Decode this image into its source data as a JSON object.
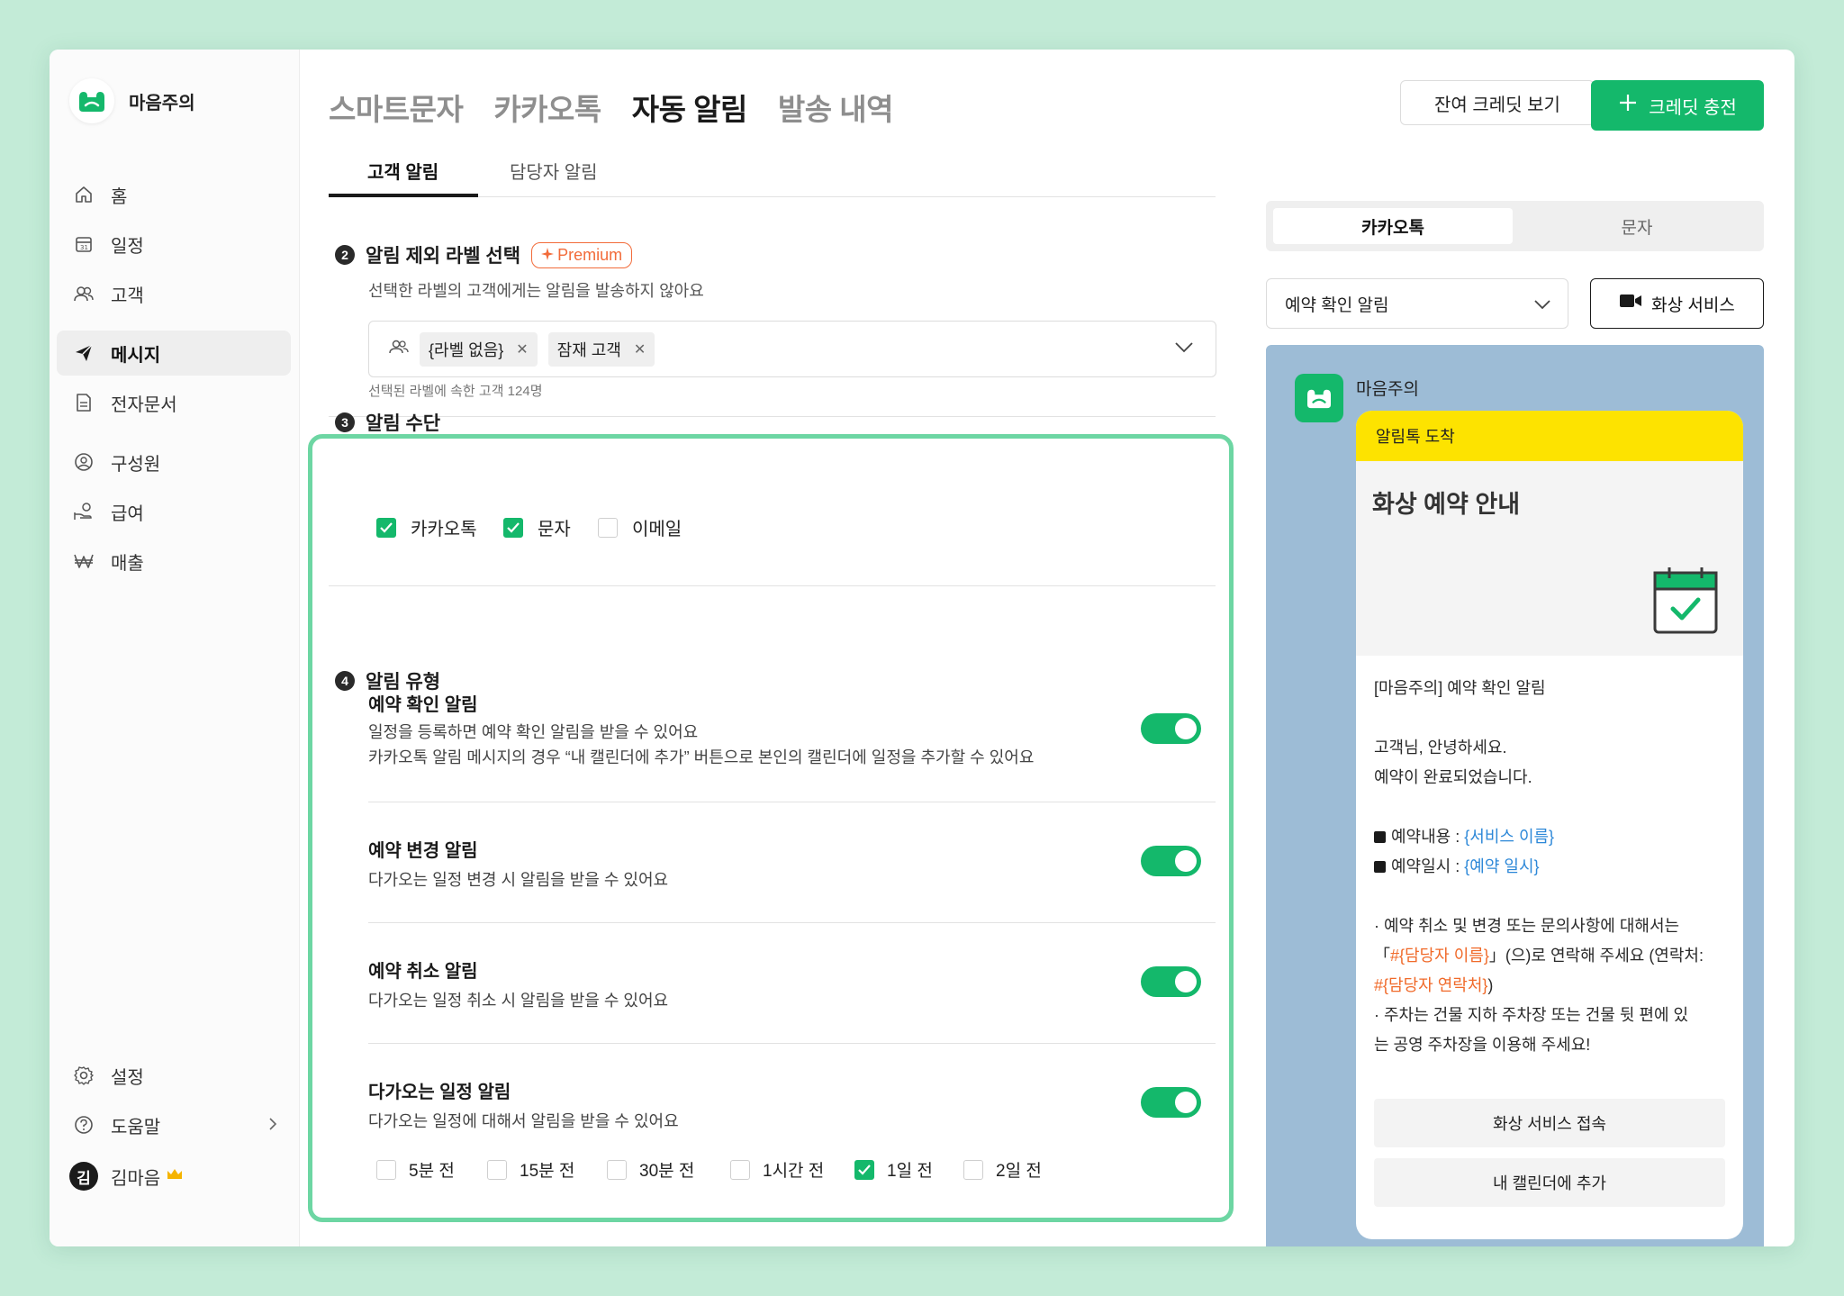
{
  "brand": {
    "name": "마음주의"
  },
  "sidebar": {
    "items": [
      {
        "label": "홈"
      },
      {
        "label": "일정"
      },
      {
        "label": "고객"
      },
      {
        "label": "메시지"
      },
      {
        "label": "전자문서"
      },
      {
        "label": "구성원"
      },
      {
        "label": "급여"
      },
      {
        "label": "매출"
      }
    ],
    "settings": "설정",
    "help": "도움말",
    "user": {
      "initial": "김",
      "name": "김마음"
    }
  },
  "header": {
    "tabs": [
      "스마트문자",
      "카카오톡",
      "자동 알림",
      "발송 내역"
    ],
    "active_tab": "자동 알림",
    "credit_view": "잔여 크레딧 보기",
    "credit_charge": "크레딧 충전"
  },
  "subtabs": [
    "고객 알림",
    "담당자 알림"
  ],
  "section2": {
    "num": "2",
    "title": "알림 제외 라벨 선택",
    "badge": "Premium",
    "desc": "선택한 라벨의 고객에게는 알림을 발송하지 않아요",
    "chips": [
      "{라벨 없음}",
      "잠재 고객"
    ],
    "note": "선택된 라벨에 속한 고객 124명"
  },
  "section3": {
    "num": "3",
    "title": "알림 수단",
    "channels": [
      {
        "label": "카카오톡",
        "checked": true
      },
      {
        "label": "문자",
        "checked": true
      },
      {
        "label": "이메일",
        "checked": false
      }
    ]
  },
  "section4": {
    "num": "4",
    "title": "알림 유형",
    "types": [
      {
        "title": "예약 확인 알림",
        "desc1": "일정을 등록하면 예약 확인 알림을 받을 수 있어요",
        "desc2": "카카오톡 알림 메시지의 경우 “내 캘린더에 추가” 버튼으로 본인의 캘린더에 일정을 추가할 수 있어요",
        "enabled": true
      },
      {
        "title": "예약 변경 알림",
        "desc1": "다가오는 일정 변경 시 알림을 받을 수 있어요",
        "enabled": true
      },
      {
        "title": "예약 취소 알림",
        "desc1": "다가오는 일정 취소 시 알림을 받을 수 있어요",
        "enabled": true
      },
      {
        "title": "다가오는 일정 알림",
        "desc1": "다가오는 일정에 대해서 알림을 받을 수 있어요",
        "enabled": true
      }
    ],
    "timings": [
      {
        "label": "5분 전",
        "checked": false
      },
      {
        "label": "15분 전",
        "checked": false
      },
      {
        "label": "30분 전",
        "checked": false
      },
      {
        "label": "1시간 전",
        "checked": false
      },
      {
        "label": "1일 전",
        "checked": true
      },
      {
        "label": "2일 전",
        "checked": false
      }
    ]
  },
  "preview": {
    "seg": [
      "카카오톡",
      "문자"
    ],
    "select_value": "예약 확인 알림",
    "video_button": "화상 서비스",
    "sender": "마음주의",
    "bubble_header": "알림톡 도착",
    "bubble_title": "화상 예약 안내",
    "line_intro": "[마음주의] 예약 확인 알림",
    "line_greet1": "고객님, 안녕하세요.",
    "line_greet2": "예약이 완료되었습니다.",
    "item1_label": "예약내용 : ",
    "item1_var": "{서비스 이름}",
    "item2_label": "예약일시 : ",
    "item2_var": "{예약 일시}",
    "notice1_a": "· 예약 취소 및 변경 또는 문의사항에 대해서는",
    "notice1_b_pre": "「",
    "notice1_b_var": "#{담당자 이름}",
    "notice1_b_post": "」(으)로 연락해 주세요 (연락처:",
    "notice1_c_var": "#{담당자 연락처}",
    "notice1_c_post": ")",
    "notice2_a": "· 주차는 건물 지하 주차장 또는 건물 뒷 편에 있",
    "notice2_b": "는 공영 주차장을 이용해 주세요!",
    "btn1": "화상 서비스 접속",
    "btn2": "내 캘린더에 추가"
  },
  "colors": {
    "accent": "#14b86b",
    "highlight": "#6dd6a3",
    "kakao_yellow": "#fde300",
    "preview_bg": "#9dbcd6",
    "premium": "#f26b3a"
  }
}
